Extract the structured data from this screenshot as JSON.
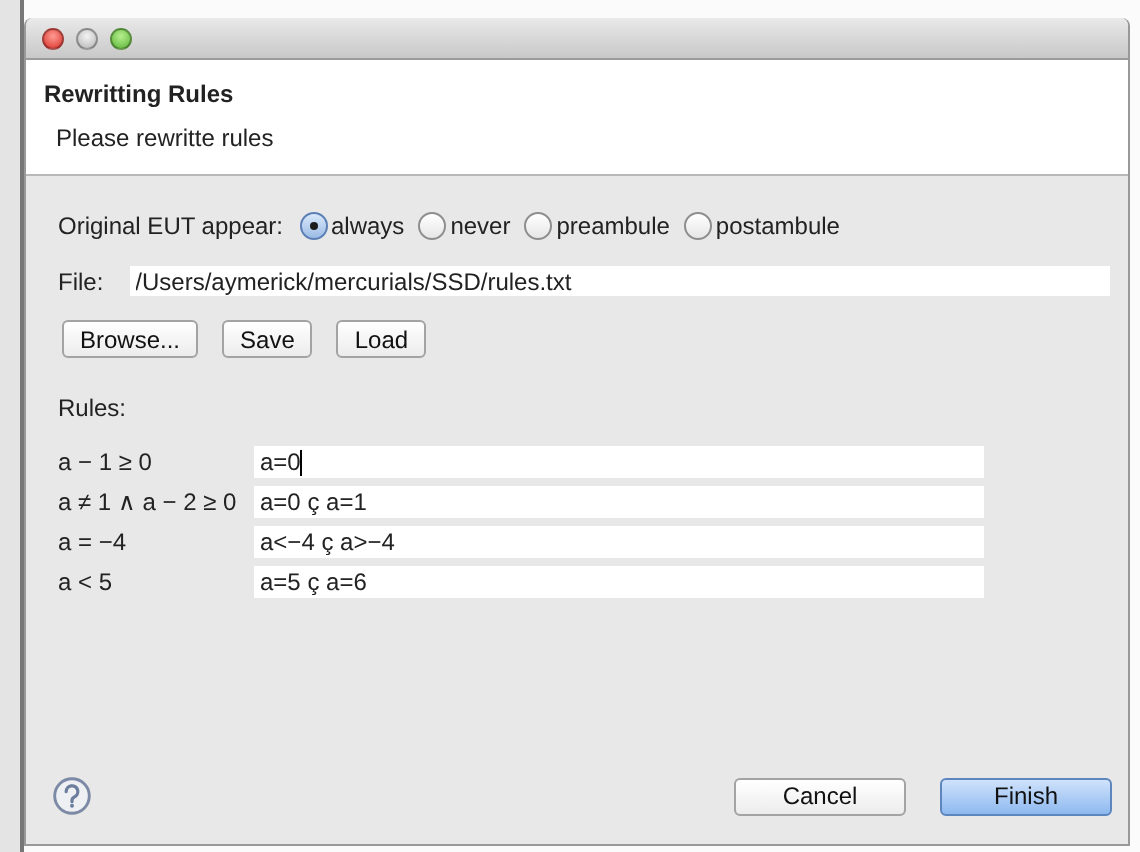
{
  "window": {
    "title": "Rewritting Rules",
    "subtitle": "Please rewritte rules"
  },
  "appear": {
    "label": "Original EUT appear:",
    "options": [
      {
        "label": "always",
        "selected": true
      },
      {
        "label": "never",
        "selected": false
      },
      {
        "label": "preambule",
        "selected": false
      },
      {
        "label": "postambule",
        "selected": false
      }
    ]
  },
  "file": {
    "label": "File:",
    "value": "/Users/aymerick/mercurials/SSD/rules.txt"
  },
  "file_buttons": [
    "Browse...",
    "Save",
    "Load"
  ],
  "rules": {
    "label": "Rules:",
    "rows": [
      {
        "condition": "a − 1 ≥ 0",
        "value": "a=0",
        "focused": true
      },
      {
        "condition": "a ≠ 1 ∧ a − 2 ≥ 0",
        "value": "a=0 ç a=1",
        "focused": false
      },
      {
        "condition": "a = −4",
        "value": "a<−4 ç a>−4",
        "focused": false
      },
      {
        "condition": "a < 5",
        "value": "a=5 ç a=6",
        "focused": false
      }
    ]
  },
  "footer_buttons": [
    {
      "label": "Cancel",
      "kind": "normal"
    },
    {
      "label": "Finish",
      "kind": "default"
    }
  ]
}
